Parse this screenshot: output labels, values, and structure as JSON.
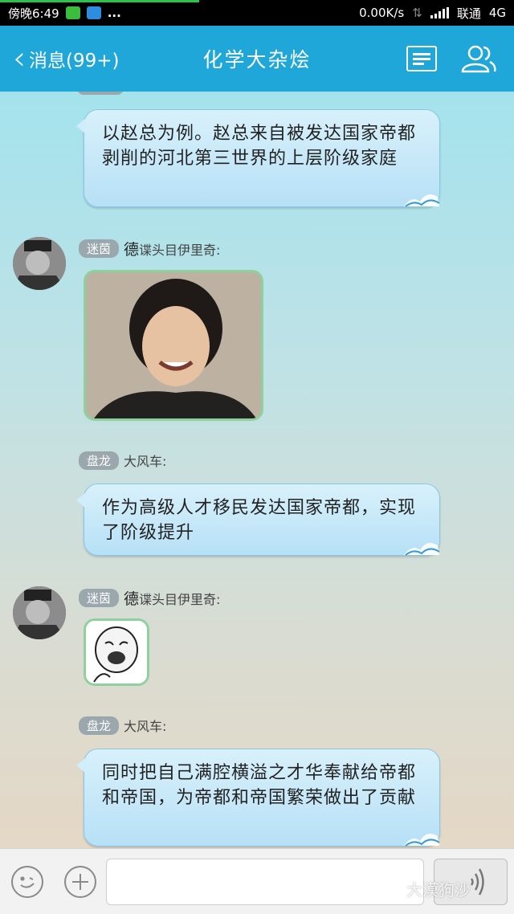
{
  "status_bar": {
    "time": "傍晚6:49",
    "more": "...",
    "speed": "0.00K/s",
    "carrier": "联通",
    "network": "4G"
  },
  "header": {
    "back_label": "消息(99+)",
    "title": "化学大杂烩",
    "list_icon": "list-icon",
    "group_icon": "group-icon"
  },
  "messages": [
    {
      "type": "text",
      "text": "以赵总为例。赵总来自被发达国家帝都剥削的河北第三世界的上层阶级家庭"
    },
    {
      "type": "image",
      "tag": "迷茵",
      "sender": "德",
      "sender_suffix": "谍头目伊里奇:"
    },
    {
      "type": "text",
      "tag": "盘龙",
      "sender": "大风车:",
      "text": "作为高级人才移民发达国家帝都，实现了阶级提升"
    },
    {
      "type": "sticker",
      "tag": "迷茵",
      "sender": "德",
      "sender_suffix": "谍头目伊里奇:"
    },
    {
      "type": "text",
      "tag": "盘龙",
      "sender": "大风车:",
      "text": "同时把自己满腔横溢之才华奉献给帝都和帝国，为帝都和帝国繁荣做出了贡献"
    }
  ],
  "input_bar": {
    "emoji_icon": "emoji-icon",
    "plus_icon": "plus-icon",
    "voice_icon": "voice-icon",
    "input_value": "",
    "watermark": "大漠狗沙"
  },
  "colors": {
    "header_bg": "#1ea7d8",
    "bubble": "#c4e7f8",
    "tag": "#9aa7ad"
  }
}
